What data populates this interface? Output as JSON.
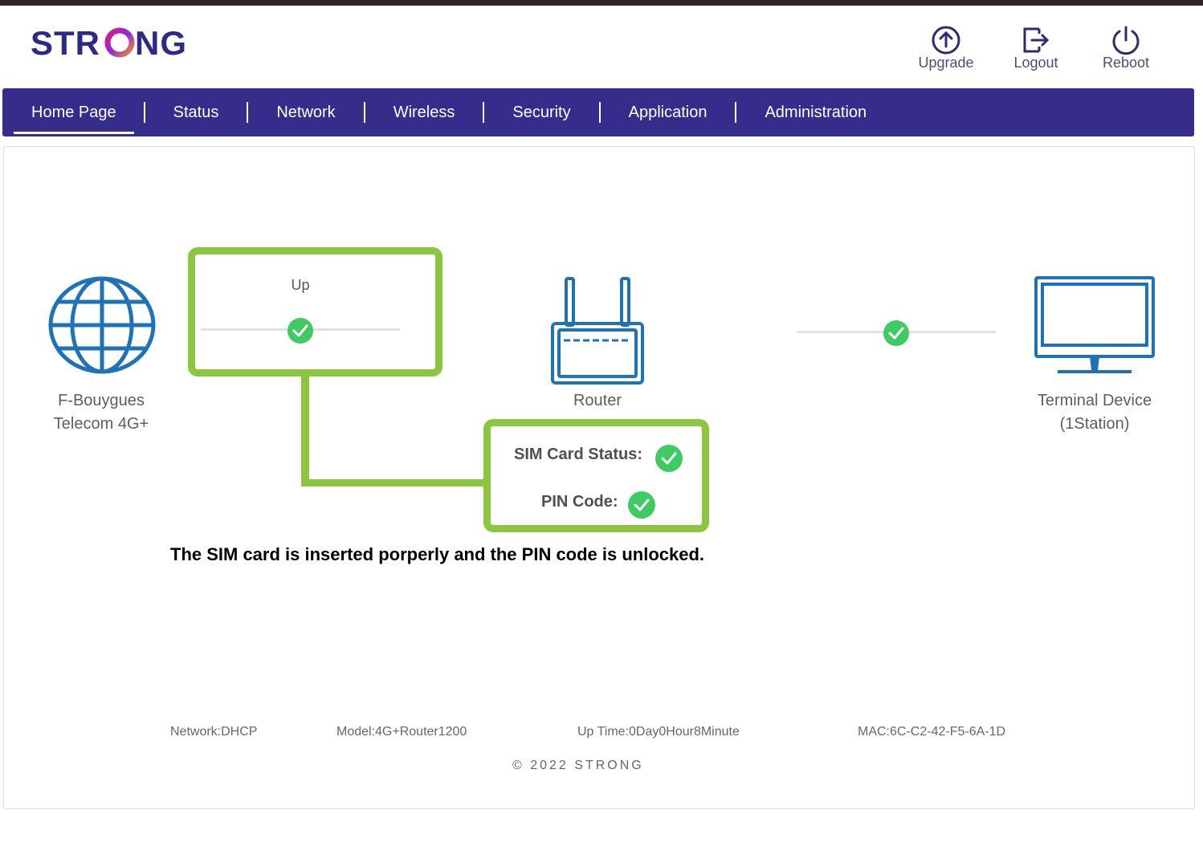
{
  "brand": {
    "logo_text": "STRONG"
  },
  "header": {
    "actions": [
      {
        "label": "Upgrade",
        "icon": "upgrade-icon"
      },
      {
        "label": "Logout",
        "icon": "logout-icon"
      },
      {
        "label": "Reboot",
        "icon": "power-icon"
      }
    ]
  },
  "nav": {
    "items": [
      "Home Page",
      "Status",
      "Network",
      "Wireless",
      "Security",
      "Application",
      "Administration"
    ],
    "active": "Home Page"
  },
  "diagram": {
    "isp": {
      "line1": "F-Bouygues",
      "line2": "Telecom 4G+",
      "icon": "globe-icon"
    },
    "wan_status": "Up",
    "router": {
      "label": "Router",
      "icon": "router-icon"
    },
    "terminal": {
      "line1": "Terminal Device",
      "line2": "(1Station)",
      "icon": "monitor-icon"
    },
    "sim": {
      "status_label": "SIM Card Status:",
      "pin_label": "PIN Code:"
    }
  },
  "annotation": "The SIM card is inserted porperly and the PIN code is unlocked.",
  "footer": {
    "network": "Network:DHCP",
    "model": "Model:4G+Router1200",
    "uptime": "Up Time:0Day0Hour8Minute",
    "mac": "MAC:6C-C2-42-F5-6A-1D",
    "copyright": "© 2022 STRONG"
  },
  "colors": {
    "nav_bg": "#362c8c",
    "highlight": "#8cc63f",
    "check": "#3ecb63",
    "icon_blue": "#1e73b8"
  }
}
